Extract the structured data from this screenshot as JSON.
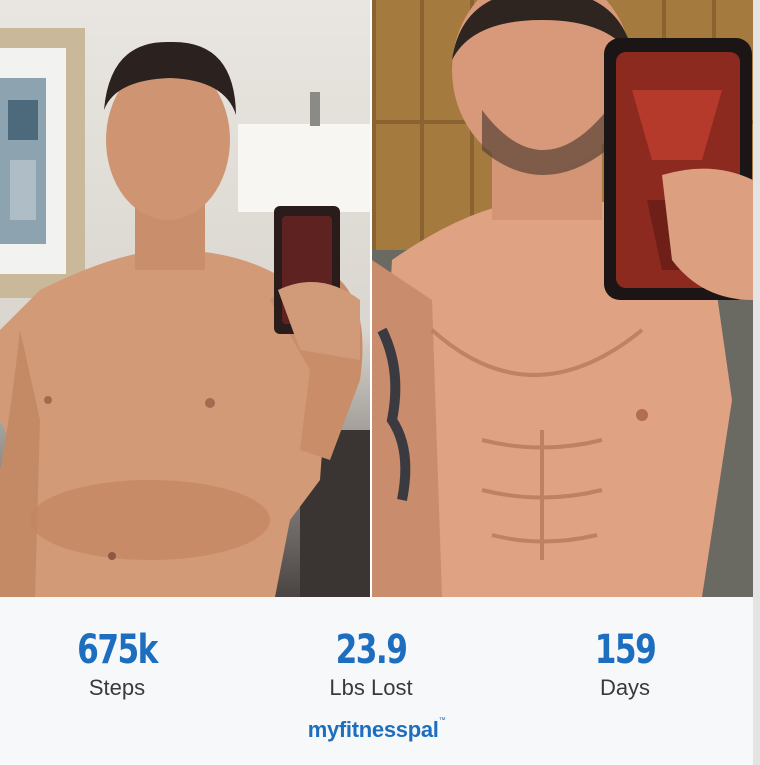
{
  "images": [
    {
      "name": "before-photo",
      "description_icon": "person-photo"
    },
    {
      "name": "after-photo",
      "description_icon": "person-photo"
    }
  ],
  "stats": [
    {
      "value": "675k",
      "label": "Steps"
    },
    {
      "value": "23.9",
      "label": "Lbs Lost"
    },
    {
      "value": "159",
      "label": "Days"
    }
  ],
  "brand": {
    "name": "myfitnesspal",
    "mark": "™"
  },
  "colors": {
    "accent": "#1e6ec0",
    "label": "#3a3a3a",
    "footer_bg": "#f7f8fa"
  }
}
